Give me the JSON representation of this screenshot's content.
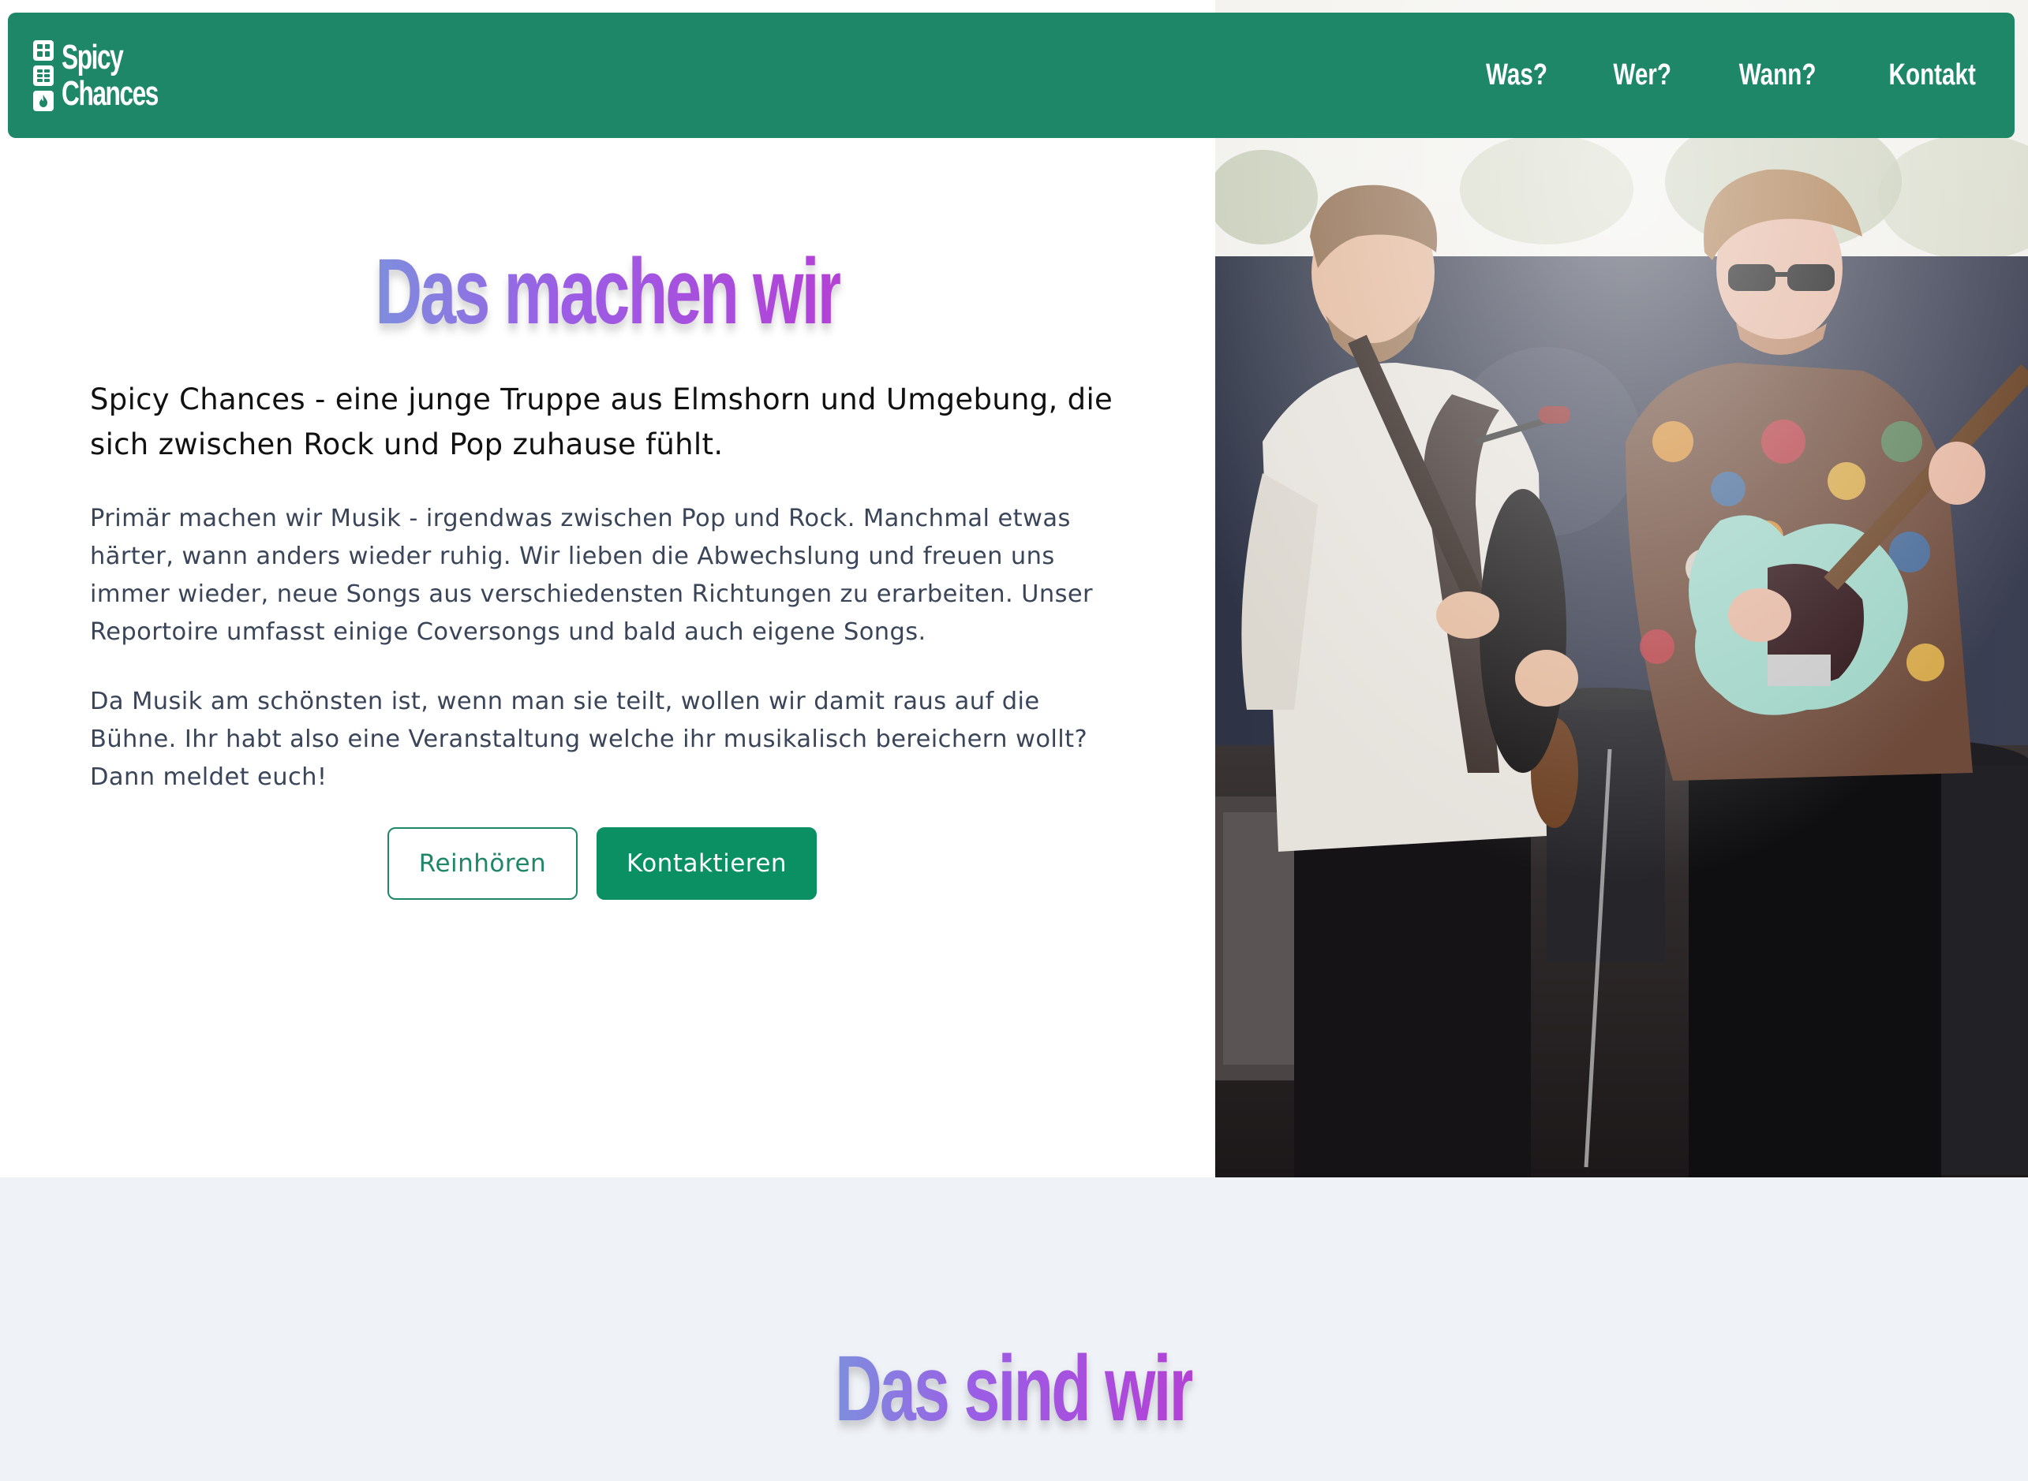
{
  "header": {
    "logo": {
      "line1": "Spicy",
      "line2": "Chances"
    },
    "nav": [
      {
        "label": "Was?"
      },
      {
        "label": "Wer?"
      },
      {
        "label": "Wann?"
      },
      {
        "label": "Kontakt"
      }
    ],
    "background": "#1d8768"
  },
  "hero": {
    "title": "Das machen wir",
    "lead": "Spicy Chances - eine junge Truppe aus Elmshorn und Umgebung, die sich zwischen Rock und Pop zuhause fühlt.",
    "paragraphs": [
      "Primär machen wir Musik - irgendwas zwischen Pop und Rock. Manchmal etwas härter, wann anders wieder ruhig. Wir lieben die Abwechslung und freuen uns immer wieder, neue Songs aus verschiedensten Richtungen zu erarbeiten. Unser Reportoire umfasst einige Coversongs und bald auch eigene Songs.",
      "Da Musik am schönsten ist, wenn man sie teilt, wollen wir damit raus auf die Bühne. Ihr habt also eine Veranstaltung welche ihr musikalisch bereichern wollt? Dann meldet euch!"
    ],
    "buttons": {
      "listen": "Reinhören",
      "contact": "Kontaktieren"
    },
    "accent": "#0b9064"
  },
  "section2": {
    "title": "Das sind wir",
    "background": "#eff2f7"
  }
}
